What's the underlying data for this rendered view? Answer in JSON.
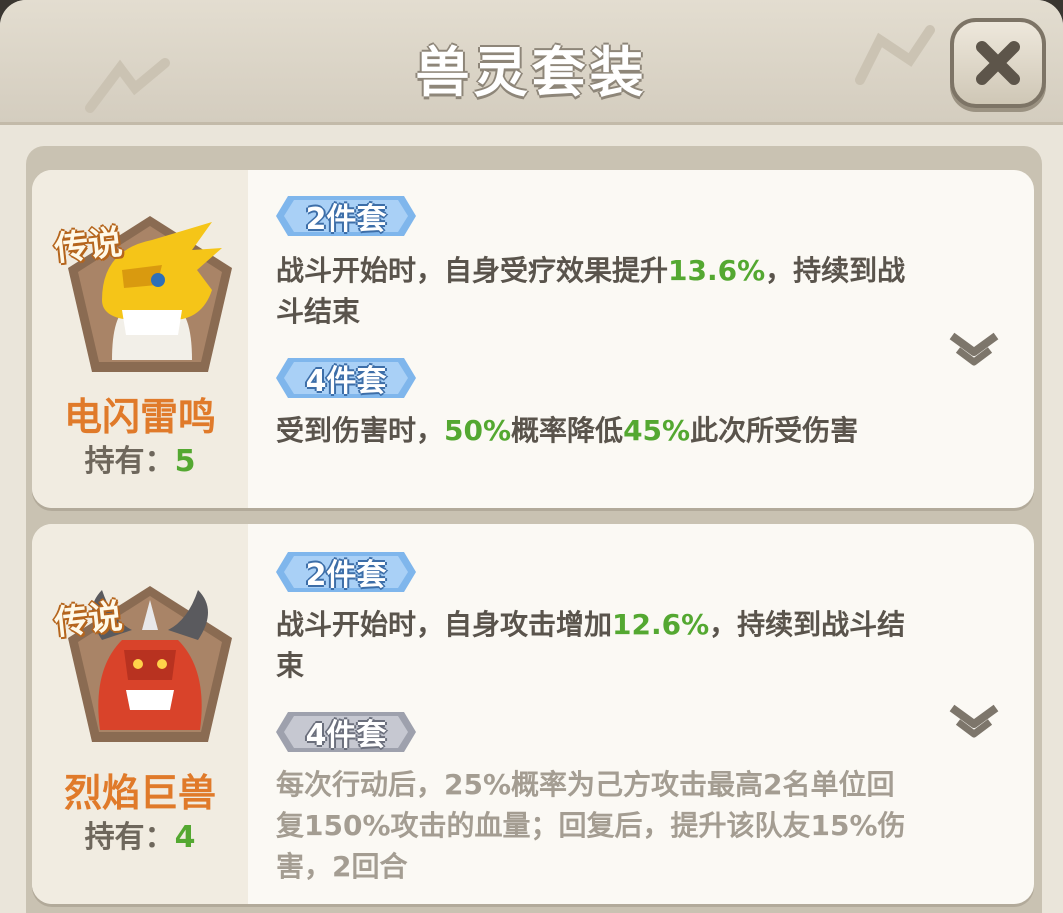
{
  "title": "兽灵套装",
  "icons": {
    "close": "close-x-icon",
    "expand": "chevron-down-icon"
  },
  "colors": {
    "highlight": "#54a831",
    "name": "#e07a2a",
    "active_tag": "#7fb6ec",
    "inactive_tag": "#b6b9c4"
  },
  "sets": [
    {
      "rarity": "传说",
      "name": "电闪雷鸣",
      "hold_label": "持有：",
      "hold_count": "5",
      "bonuses": [
        {
          "tag": "2件套",
          "active": true,
          "parts": [
            {
              "text": "战斗开始时，自身受疗效果提升",
              "hl": false
            },
            {
              "text": "13.6%",
              "hl": true
            },
            {
              "text": "，持续到战斗结束",
              "hl": false
            }
          ]
        },
        {
          "tag": "4件套",
          "active": true,
          "parts": [
            {
              "text": "受到伤害时，",
              "hl": false
            },
            {
              "text": "50%",
              "hl": true
            },
            {
              "text": "概率降低",
              "hl": false
            },
            {
              "text": "45%",
              "hl": true
            },
            {
              "text": "此次所受伤害",
              "hl": false
            }
          ]
        }
      ]
    },
    {
      "rarity": "传说",
      "name": "烈焰巨兽",
      "hold_label": "持有：",
      "hold_count": "4",
      "bonuses": [
        {
          "tag": "2件套",
          "active": true,
          "parts": [
            {
              "text": "战斗开始时，自身攻击增加",
              "hl": false
            },
            {
              "text": "12.6%",
              "hl": true
            },
            {
              "text": "，持续到战斗结束",
              "hl": false
            }
          ]
        },
        {
          "tag": "4件套",
          "active": false,
          "parts": [
            {
              "text": "每次行动后，25%概率为己方攻击最高2名单位回复150%攻击的血量；回复后，提升该队友15%伤害，2回合",
              "hl": false
            }
          ]
        }
      ]
    }
  ]
}
